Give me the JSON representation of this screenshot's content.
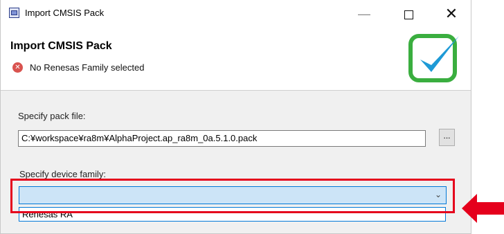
{
  "window": {
    "title": "Import CMSIS Pack",
    "close_glyph": "✕",
    "minimize_glyph": "—"
  },
  "header": {
    "title": "Import CMSIS Pack",
    "error_message": "No Renesas Family selected"
  },
  "pack_file": {
    "label": "Specify pack file:",
    "value": "C:¥workspace¥ra8m¥AlphaProject.ap_ra8m_0a.5.1.0.pack",
    "browse_label": "..."
  },
  "device_family": {
    "label": "Specify device family:",
    "value": "",
    "options": [
      "Renesas RA"
    ]
  },
  "colors": {
    "highlight": "#e5001c",
    "selection": "#cce4f7",
    "logo_green": "#3aae3f",
    "logo_blue": "#1e9ad6"
  },
  "icons": {
    "app": "cmsis-pack-icon",
    "error": "error-icon",
    "logo": "checkmark-logo-icon",
    "annotation": "red-arrow-icon"
  }
}
